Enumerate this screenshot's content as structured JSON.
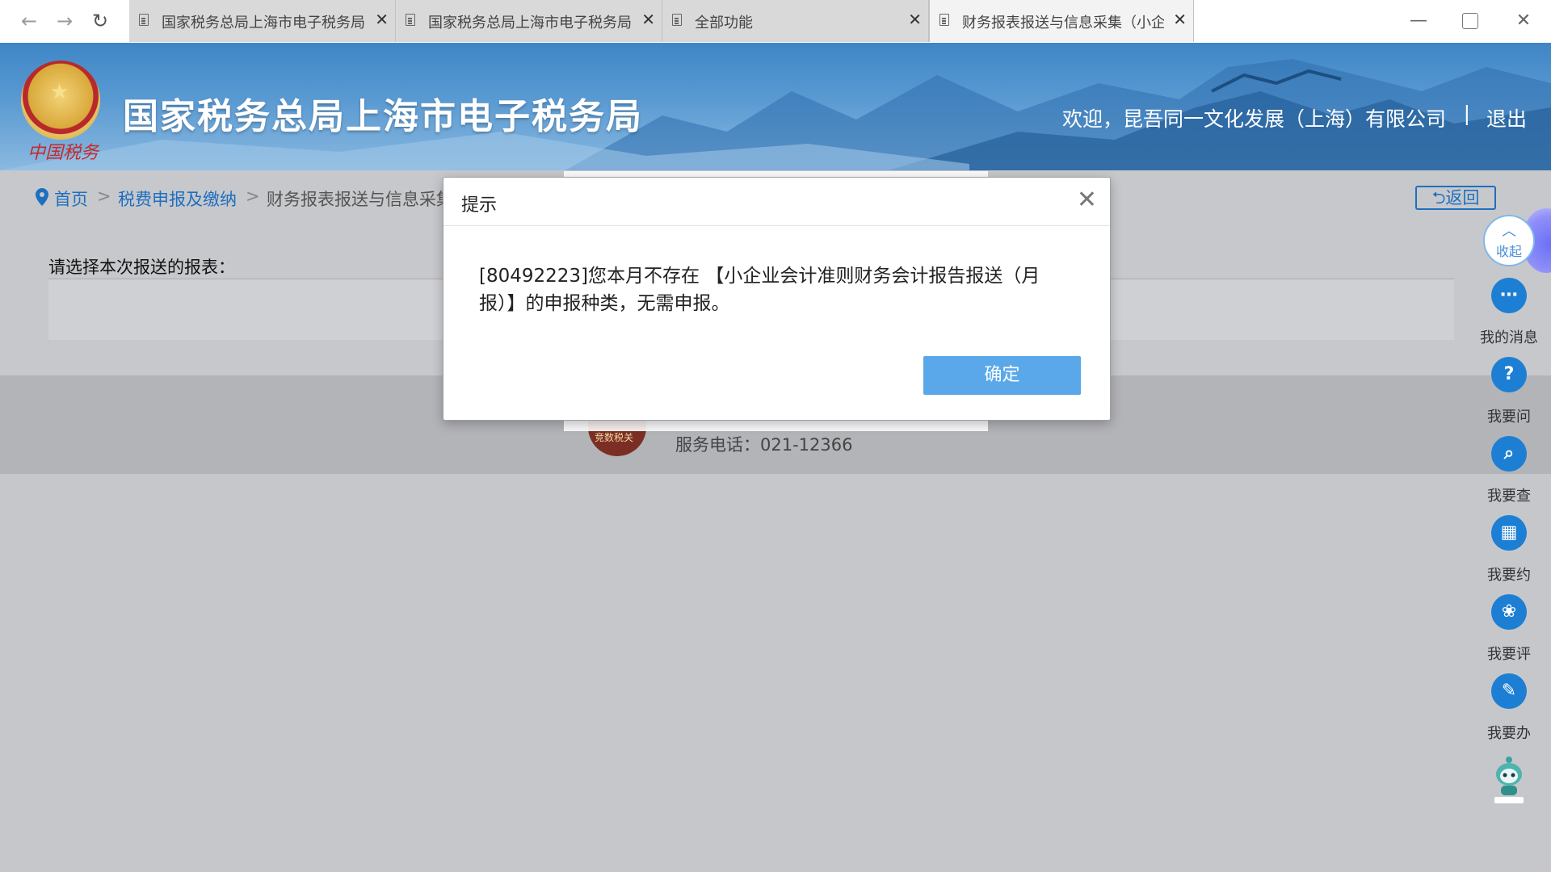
{
  "browser": {
    "tabs": [
      {
        "title": "国家税务总局上海市电子税务局"
      },
      {
        "title": "国家税务总局上海市电子税务局"
      },
      {
        "title": "全部功能"
      },
      {
        "title": "财务报表报送与信息采集（小企"
      }
    ]
  },
  "header": {
    "emblem_caption": "中国税务",
    "site_title": "国家税务总局上海市电子税务局",
    "welcome": "欢迎，昆吾同一文化发展（上海）有限公司",
    "separator": "|",
    "logout": "退出"
  },
  "breadcrumb": {
    "home": "首页",
    "sep": ">",
    "level1": "税费申报及缴纳",
    "level2": "财务报表报送与信息采集",
    "back": "返回"
  },
  "content": {
    "prompt": "请选择本次报送的报表："
  },
  "footer": {
    "badge": "竞数税关",
    "service_phone": "服务电话：021-12366"
  },
  "modal": {
    "title": "提示",
    "message": "[80492223]您本月不存在 【小企业会计准则财务会计报告报送（月报）】的申报种类，无需申报。",
    "ok": "确定"
  },
  "dock": {
    "collapse": "收起",
    "items": [
      {
        "label": "我的消息",
        "icon": "message-icon"
      },
      {
        "label": "我要问",
        "icon": "question-icon"
      },
      {
        "label": "我要查",
        "icon": "search-icon"
      },
      {
        "label": "我要约",
        "icon": "calendar-icon"
      },
      {
        "label": "我要评",
        "icon": "evaluate-icon"
      },
      {
        "label": "我要办",
        "icon": "edit-icon"
      }
    ]
  },
  "colors": {
    "link": "#1e6fbf",
    "primary_button": "#5aa8ea",
    "dock_icon": "#1d7fd4",
    "banner": "#3f86c6"
  }
}
